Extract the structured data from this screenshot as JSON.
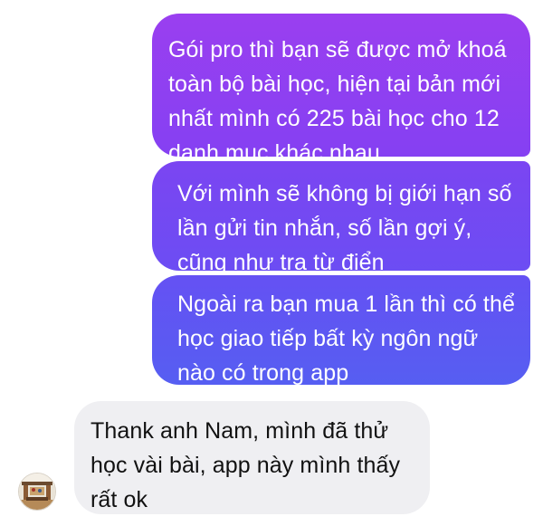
{
  "messages": {
    "outgoing": [
      {
        "lines": [
          "Gói pro thì bạn sẽ được mở khoá",
          "toàn bộ bài học, hiện tại bản mới",
          "nhất mình có 225 bài học cho 12",
          "danh mục khác nhau"
        ]
      },
      {
        "lines": [
          "Với mình sẽ không bị giới hạn số",
          "lần gửi tin nhắn, số lần gợi ý,",
          "cũng như tra từ điển"
        ]
      },
      {
        "lines": [
          "Ngoài ra bạn mua 1 lần thì có thể",
          "học giao tiếp bất kỳ ngôn ngữ",
          "nào có trong app"
        ]
      }
    ],
    "incoming": [
      {
        "lines": [
          "Thank anh Nam, mình đã thử",
          "học vài bài, app này mình thấy",
          "rất ok"
        ]
      }
    ]
  },
  "colors": {
    "outgoing_top": "#9a3ff0",
    "outgoing_bottom": "#565ef2",
    "incoming_bg": "#efeff2",
    "incoming_text": "#111111"
  },
  "avatar": {
    "icon": "user-avatar-photo"
  }
}
